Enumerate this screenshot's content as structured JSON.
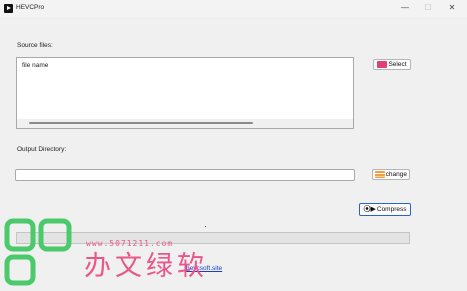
{
  "window": {
    "title": "HEVCPro",
    "minimize_glyph": "—",
    "maximize_glyph": "☐",
    "close_glyph": "✕"
  },
  "source": {
    "label": "Source files:",
    "column_header": "file name",
    "select_button": "Select",
    "select_icon": "checkbox-icon"
  },
  "output": {
    "label": "Output Directory:",
    "path_value": "",
    "change_button": "change",
    "change_icon": "folder-icon"
  },
  "compress": {
    "button_label": "Compress",
    "icon_glyph": "⦿▶"
  },
  "progress": {
    "value": 0
  },
  "footer": {
    "link_text": "hevcsoft.site"
  },
  "watermark": {
    "url": "www.5071211.com",
    "text": "办文绿软",
    "color": "#e8578a",
    "logo_color": "#4cc96a"
  }
}
